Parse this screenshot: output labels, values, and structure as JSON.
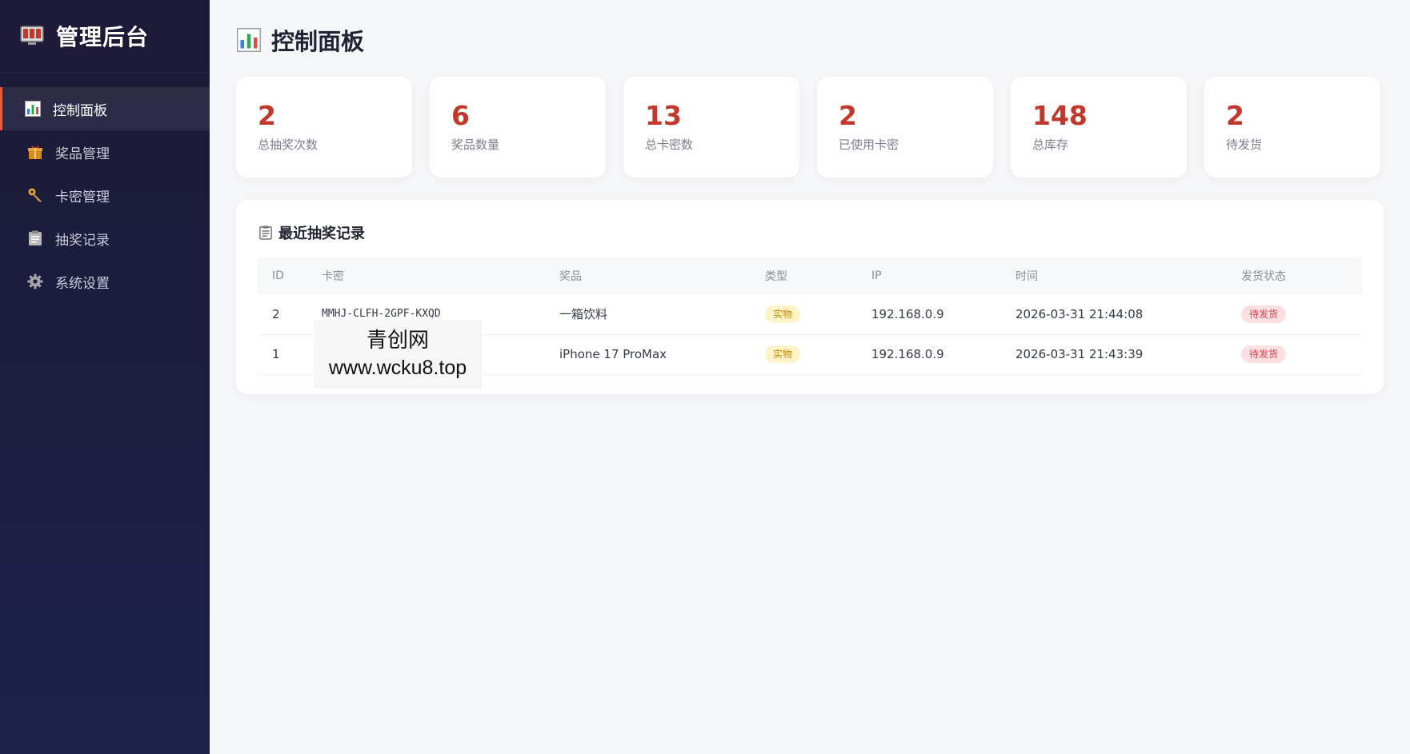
{
  "sidebar": {
    "brand": {
      "title": "管理后台",
      "icon": "monitor-icon"
    },
    "items": [
      {
        "label": "控制面板",
        "icon": "bar-chart-icon",
        "active": true
      },
      {
        "label": "奖品管理",
        "icon": "gift-icon",
        "active": false
      },
      {
        "label": "卡密管理",
        "icon": "key-icon",
        "active": false
      },
      {
        "label": "抽奖记录",
        "icon": "clipboard-icon",
        "active": false
      },
      {
        "label": "系统设置",
        "icon": "gear-icon",
        "active": false
      }
    ]
  },
  "header": {
    "title": "控制面板",
    "icon": "bar-chart-icon"
  },
  "stats": [
    {
      "value": "2",
      "label": "总抽奖次数"
    },
    {
      "value": "6",
      "label": "奖品数量"
    },
    {
      "value": "13",
      "label": "总卡密数"
    },
    {
      "value": "2",
      "label": "已使用卡密"
    },
    {
      "value": "148",
      "label": "总库存"
    },
    {
      "value": "2",
      "label": "待发货"
    }
  ],
  "records": {
    "title": "最近抽奖记录",
    "icon": "clipboard-icon",
    "columns": [
      "ID",
      "卡密",
      "奖品",
      "类型",
      "IP",
      "时间",
      "发货状态"
    ],
    "rows": [
      {
        "id": "2",
        "key": "MMHJ-CLFH-2GPF-KXQD",
        "prize": "一箱饮料",
        "type": "实物",
        "ip": "192.168.0.9",
        "time": "2026-03-31 21:44:08",
        "status": "待发货"
      },
      {
        "id": "1",
        "key": "",
        "prize": "iPhone 17 ProMax",
        "type": "实物",
        "ip": "192.168.0.9",
        "time": "2026-03-31 21:43:39",
        "status": "待发货"
      }
    ]
  },
  "watermark": {
    "line1": "青创网",
    "line2": "www.wcku8.top"
  },
  "colors": {
    "accent": "#c0392b",
    "sidebar_bg": "#1c1a36",
    "type_badge_bg": "#fff3c9",
    "status_badge_bg": "#fbdfe1"
  }
}
